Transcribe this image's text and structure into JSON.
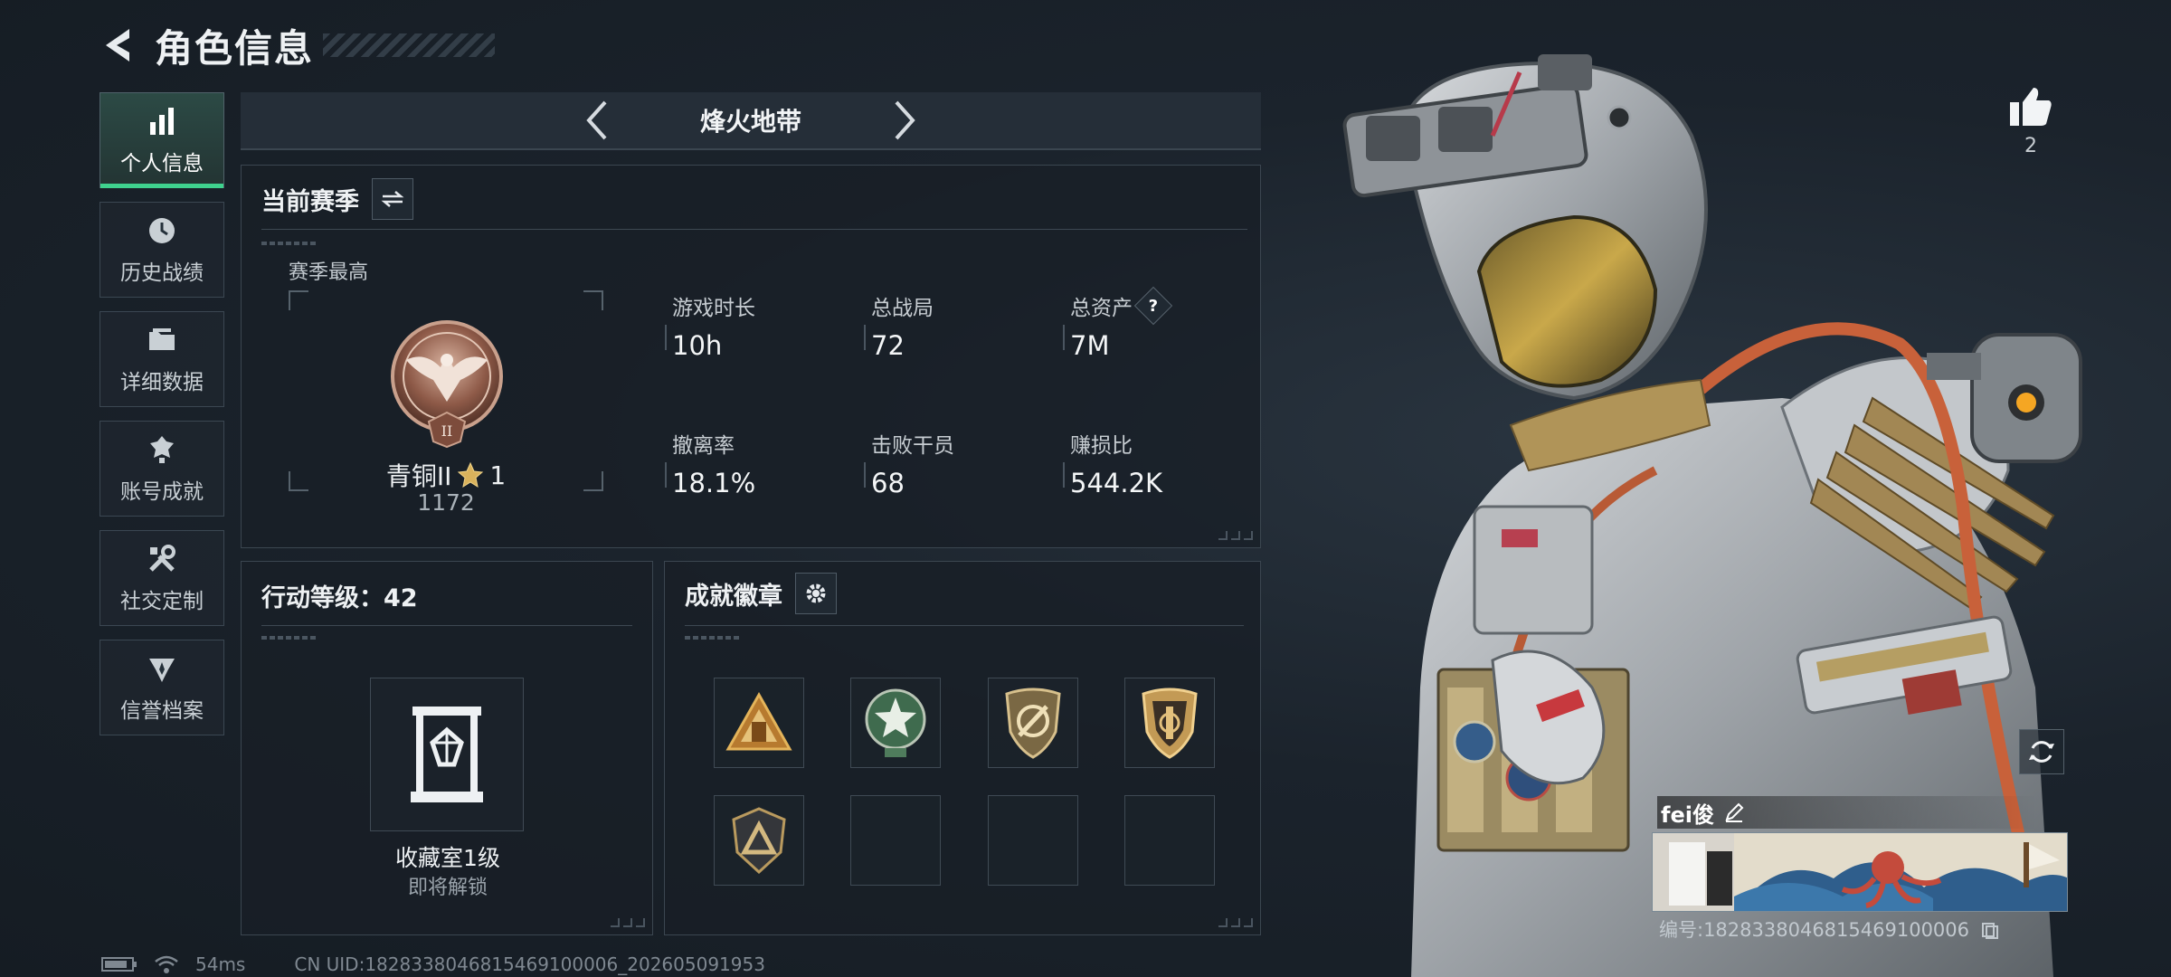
{
  "header": {
    "title": "角色信息"
  },
  "sidebar": {
    "items": [
      {
        "label": "个人信息",
        "icon": "bar-chart-icon",
        "active": true
      },
      {
        "label": "历史战绩",
        "icon": "history-clock-icon"
      },
      {
        "label": "详细数据",
        "icon": "folder-icon"
      },
      {
        "label": "账号成就",
        "icon": "achievement-icon"
      },
      {
        "label": "社交定制",
        "icon": "wrench-tools-icon"
      },
      {
        "label": "信誉档案",
        "icon": "credit-badge-icon"
      }
    ]
  },
  "mode": {
    "name": "烽火地带"
  },
  "season": {
    "title": "当前赛季",
    "best_label": "赛季最高",
    "rank_name": "青铜II",
    "rank_stars": "1",
    "rank_score": "1172",
    "rank_emblem_numeral": "II",
    "stats": [
      {
        "label": "游戏时长",
        "value": "10h"
      },
      {
        "label": "总战局",
        "value": "72"
      },
      {
        "label": "总资产",
        "value": "7M",
        "help": "?"
      },
      {
        "label": "撤离率",
        "value": "18.1%"
      },
      {
        "label": "击败干员",
        "value": "68"
      },
      {
        "label": "赚损比",
        "value": "544.2K"
      }
    ]
  },
  "level": {
    "title": "行动等级：42",
    "collection_name": "收藏室1级",
    "collection_status": "即将解锁"
  },
  "badges": {
    "title": "成就徽章",
    "slots": [
      {
        "icon": "triangle-squad-badge-icon",
        "filled": true
      },
      {
        "icon": "green-star-wreath-badge-icon",
        "filled": true
      },
      {
        "icon": "shield-slash-badge-icon",
        "filled": true
      },
      {
        "icon": "shield-crest-badge-icon",
        "filled": true
      },
      {
        "icon": "shield-triangle-badge-icon",
        "filled": true
      },
      {
        "filled": false
      },
      {
        "filled": false
      },
      {
        "filled": false
      }
    ]
  },
  "footer": {
    "ping": "54ms",
    "uid_text": "CN UID:1828338046815469100006_202605091953"
  },
  "profile": {
    "likes": "2",
    "player_name": "fei俊",
    "player_id": "编号:1828338046815469100006"
  },
  "colors": {
    "accent_green": "#3fd28e",
    "background": "#1a222b",
    "panel_border": "#3b4650"
  }
}
